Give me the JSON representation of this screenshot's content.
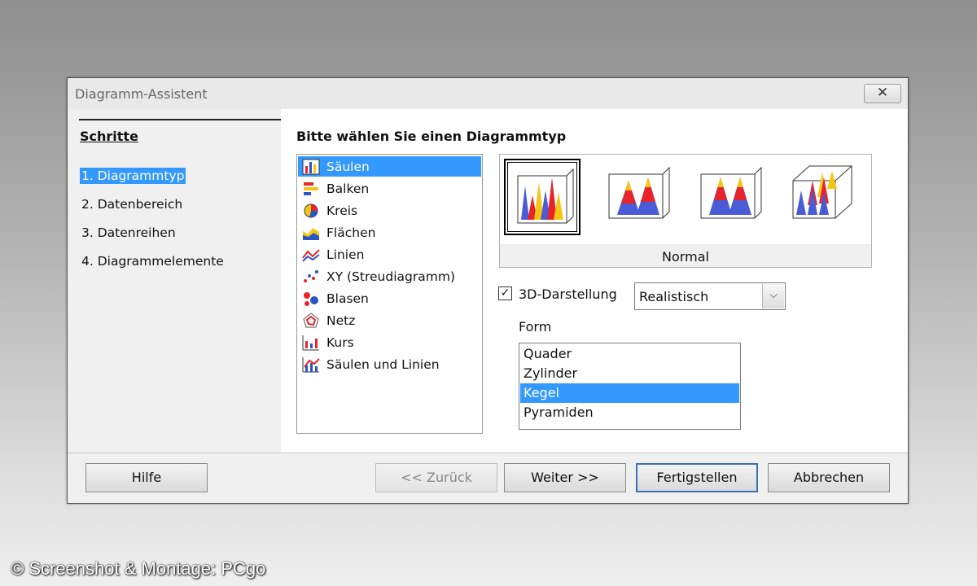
{
  "window": {
    "title": "Diagramm-Assistent",
    "close_glyph": "✕"
  },
  "steps": {
    "title": "Schritte",
    "items": [
      {
        "label": "1. Diagrammtyp",
        "active": true
      },
      {
        "label": "2. Datenbereich",
        "active": false
      },
      {
        "label": "3. Datenreihen",
        "active": false
      },
      {
        "label": "4. Diagrammelemente",
        "active": false
      }
    ]
  },
  "main": {
    "heading": "Bitte wählen Sie einen Diagrammtyp",
    "chart_types": [
      {
        "label": "Säulen",
        "icon": "column-chart-icon",
        "selected": true
      },
      {
        "label": "Balken",
        "icon": "bar-chart-icon",
        "selected": false
      },
      {
        "label": "Kreis",
        "icon": "pie-chart-icon",
        "selected": false
      },
      {
        "label": "Flächen",
        "icon": "area-chart-icon",
        "selected": false
      },
      {
        "label": "Linien",
        "icon": "line-chart-icon",
        "selected": false
      },
      {
        "label": "XY (Streudiagramm)",
        "icon": "scatter-chart-icon",
        "selected": false
      },
      {
        "label": "Blasen",
        "icon": "bubble-chart-icon",
        "selected": false
      },
      {
        "label": "Netz",
        "icon": "net-chart-icon",
        "selected": false
      },
      {
        "label": "Kurs",
        "icon": "stock-chart-icon",
        "selected": false
      },
      {
        "label": "Säulen und Linien",
        "icon": "column-line-chart-icon",
        "selected": false
      }
    ],
    "variants": {
      "selected_label": "Normal",
      "items": [
        {
          "icon": "cone-normal-variant-icon",
          "selected": true
        },
        {
          "icon": "cone-stacked-variant-icon",
          "selected": false
        },
        {
          "icon": "cone-percent-stacked-variant-icon",
          "selected": false
        },
        {
          "icon": "cone-deep-variant-icon",
          "selected": false
        }
      ]
    },
    "three_d": {
      "label": "3D-Darstellung",
      "checked": true,
      "check_glyph": "✓"
    },
    "look": {
      "value": "Realistisch",
      "arrow_glyph": "⌵"
    },
    "form": {
      "label": "Form",
      "options": [
        {
          "label": "Quader",
          "selected": false
        },
        {
          "label": "Zylinder",
          "selected": false
        },
        {
          "label": "Kegel",
          "selected": true
        },
        {
          "label": "Pyramiden",
          "selected": false
        }
      ]
    }
  },
  "buttons": {
    "help": "Hilfe",
    "back": "<< Zurück",
    "next": "Weiter >>",
    "finish": "Fertigstellen",
    "cancel": "Abbrechen"
  },
  "watermark": "© Screenshot & Montage: PCgo",
  "colors": {
    "selection": "#3399ff",
    "cone_red": "#e8232a",
    "cone_yellow": "#f6c514",
    "cone_blue": "#4a5bd6"
  }
}
